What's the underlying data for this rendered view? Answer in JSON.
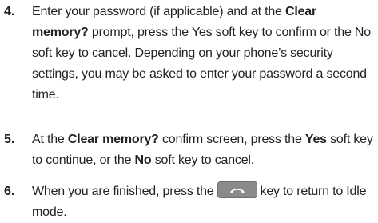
{
  "steps": [
    {
      "number": "4.",
      "segments": [
        {
          "t": "Enter your password (if applicable) and at the ",
          "b": false
        },
        {
          "t": "Clear memory?",
          "b": true
        },
        {
          "t": " prompt, press the Yes soft key to confirm or the No soft key to cancel. Depending on your phone’s security settings, you may be asked to enter your password a second time.",
          "b": false
        }
      ]
    },
    {
      "number": "5.",
      "segments": [
        {
          "t": "At the ",
          "b": false
        },
        {
          "t": "Clear memory?",
          "b": true
        },
        {
          "t": " confirm screen, press the ",
          "b": false
        },
        {
          "t": "Yes",
          "b": true
        },
        {
          "t": " soft key to continue, or the ",
          "b": false
        },
        {
          "t": "No",
          "b": true
        },
        {
          "t": " soft key to cancel.",
          "b": false
        }
      ]
    },
    {
      "number": "6.",
      "before_icon": "When you are finished, press the",
      "icon": "end-key-icon",
      "after_icon": "key to return to Idle mode."
    }
  ],
  "colors": {
    "text": "#222222",
    "key_fill": "#8a8a8a",
    "key_symbol": "#ffffff"
  }
}
